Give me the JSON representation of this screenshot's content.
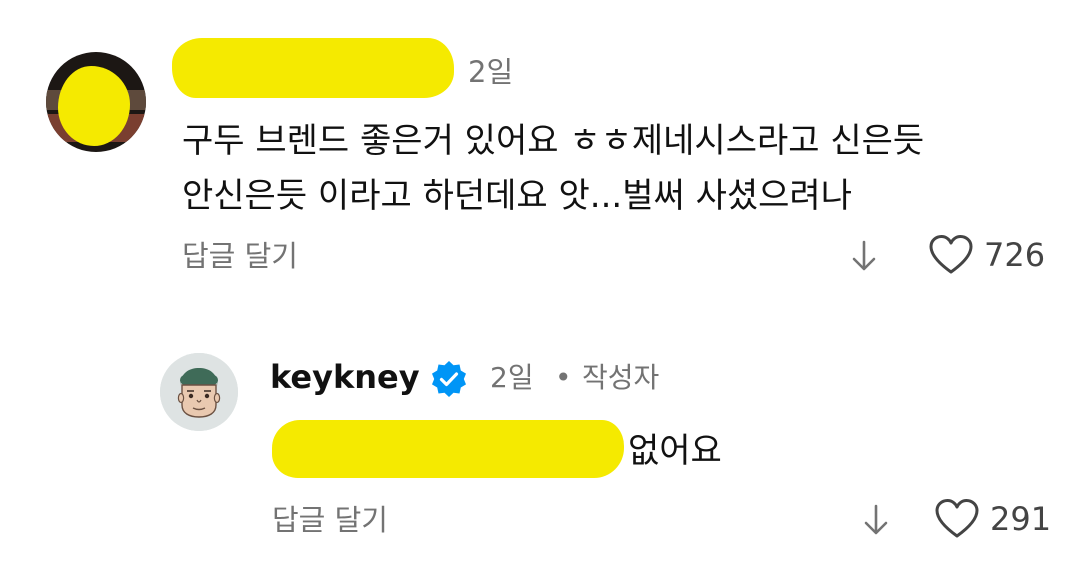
{
  "comments": [
    {
      "time": "2일",
      "text_lines": [
        "구두 브렌드 좋은거 있어요 ㅎㅎ제네시스라고 신은듯",
        "안신은듯 이라고 하던데요 앗...벌써 사셨으려나"
      ],
      "reply_label": "답글 달기",
      "likes": "726",
      "icons": {
        "dislike": "arrow-down-icon",
        "like": "heart-outline-icon"
      }
    },
    {
      "username": "keykney",
      "verified": true,
      "time": "2일",
      "separator": "•",
      "author_badge": "작성자",
      "text": "없어요",
      "reply_label": "답글 달기",
      "likes": "291",
      "icons": {
        "verified": "verified-badge-icon",
        "dislike": "arrow-down-icon",
        "like": "heart-outline-icon"
      }
    }
  ],
  "colors": {
    "redaction": "#f5ea00",
    "muted_text": "#737373",
    "verified_blue": "#0095f6",
    "text": "#111111"
  }
}
